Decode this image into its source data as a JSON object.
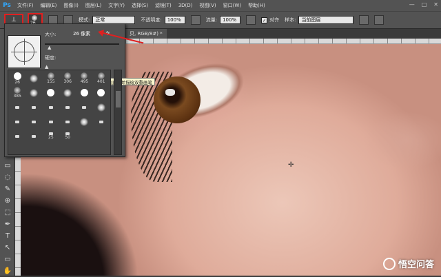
{
  "app": {
    "logo": "Ps"
  },
  "menu": [
    "文件(F)",
    "编辑(E)",
    "图像(I)",
    "图层(L)",
    "文字(Y)",
    "选择(S)",
    "滤镜(T)",
    "3D(D)",
    "视图(V)",
    "窗口(W)",
    "帮助(H)"
  ],
  "window_controls": [
    "—",
    "□",
    "✕"
  ],
  "options": {
    "brush_size_badge": "26",
    "mode_label": "模式:",
    "mode_value": "正常",
    "opacity_label": "不透明度:",
    "opacity_value": "100%",
    "flow_label": "流量:",
    "flow_value": "100%",
    "align_label": "对齐",
    "align_checked": true,
    "sample_label": "样本:",
    "sample_value": "当前图层"
  },
  "document_tab": "贝, RGB/8#) *",
  "brush_panel": {
    "size_label": "大小:",
    "size_value": "26 像素",
    "hardness_label": "硬度:",
    "tooltip": "设置主要画笔的直径并描绘双重画笔",
    "presets": [
      {
        "label": "26",
        "kind": "hard"
      },
      {
        "label": "",
        "kind": "soft"
      },
      {
        "label": "155",
        "kind": "texture"
      },
      {
        "label": "306",
        "kind": "texture"
      },
      {
        "label": "495",
        "kind": "texture"
      },
      {
        "label": "401",
        "kind": "texture"
      },
      {
        "label": "385",
        "kind": "texture"
      },
      {
        "label": "",
        "kind": "soft"
      },
      {
        "label": "",
        "kind": "hard"
      },
      {
        "label": "",
        "kind": "soft"
      },
      {
        "label": "",
        "kind": "hard"
      },
      {
        "label": "",
        "kind": "hard"
      },
      {
        "label": "",
        "kind": "small"
      },
      {
        "label": "",
        "kind": "small"
      },
      {
        "label": "",
        "kind": "small"
      },
      {
        "label": "",
        "kind": "small"
      },
      {
        "label": "",
        "kind": "small"
      },
      {
        "label": "",
        "kind": "soft"
      },
      {
        "label": "",
        "kind": "small"
      },
      {
        "label": "",
        "kind": "small"
      },
      {
        "label": "",
        "kind": "small"
      },
      {
        "label": "",
        "kind": "small"
      },
      {
        "label": "",
        "kind": "soft"
      },
      {
        "label": "",
        "kind": "small"
      },
      {
        "label": "",
        "kind": "small"
      },
      {
        "label": "",
        "kind": "small"
      },
      {
        "label": "25",
        "kind": "small"
      },
      {
        "label": "50",
        "kind": "small"
      }
    ]
  },
  "tools": [
    "▭",
    "◌",
    "✎",
    "⊕",
    "⬚",
    "✒",
    "T",
    "↖",
    "▭",
    "✋",
    "🔍"
  ],
  "watermark": "悟空问答",
  "colors": {
    "accent": "#e02020",
    "panel": "#535353",
    "ps_blue": "#31a8ff"
  }
}
